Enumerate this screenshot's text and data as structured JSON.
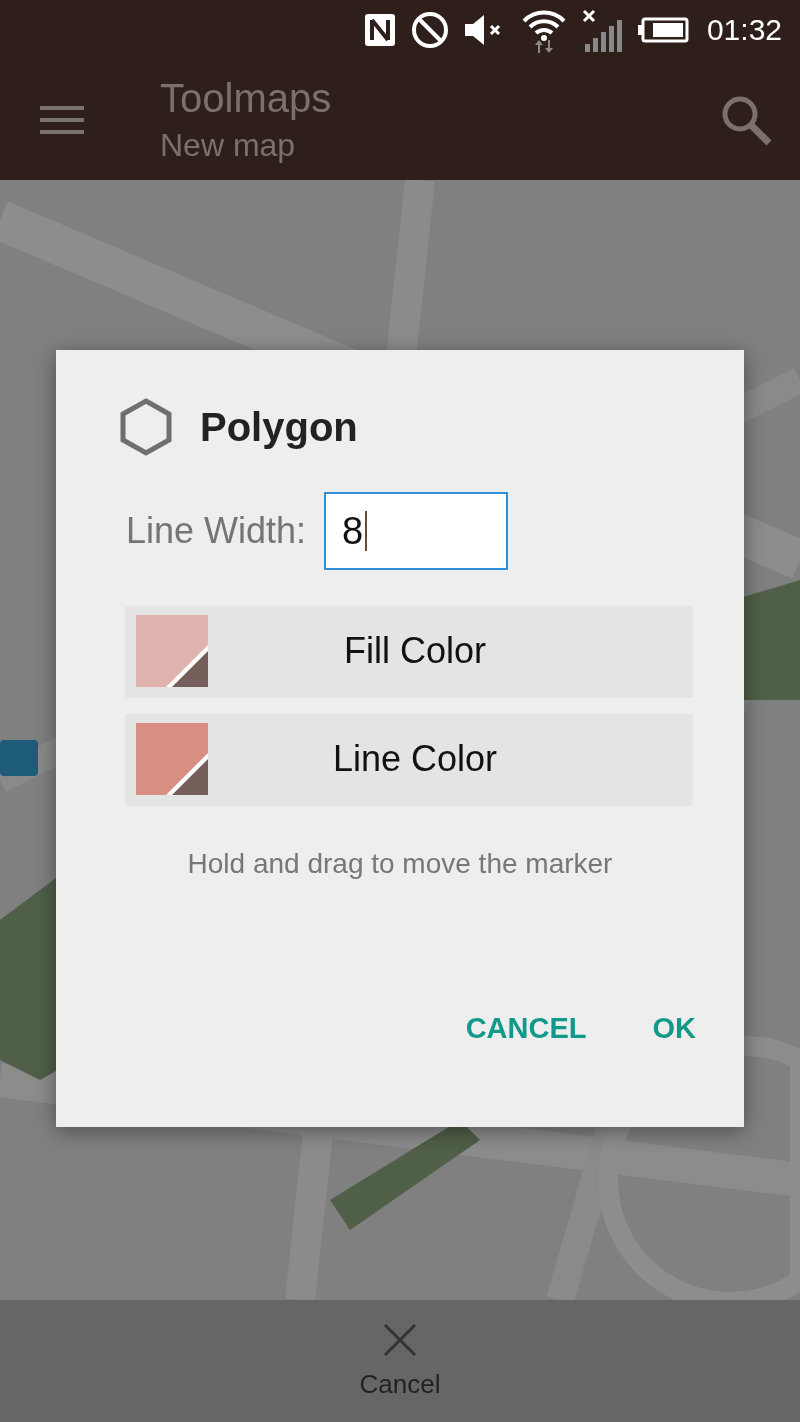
{
  "status_bar": {
    "time": "01:32"
  },
  "app_bar": {
    "title": "Toolmaps",
    "subtitle": "New map"
  },
  "dialog": {
    "title": "Polygon",
    "line_width_label": "Line Width:",
    "line_width_value": "8",
    "color_buttons": [
      {
        "label": "Fill Color",
        "color": "#e0b4ae"
      },
      {
        "label": "Line Color",
        "color": "#d98f84"
      }
    ],
    "hint": "Hold and drag to move the marker",
    "actions": [
      "CANCEL",
      "OK"
    ]
  },
  "bottom_bar": {
    "label": "Cancel"
  }
}
